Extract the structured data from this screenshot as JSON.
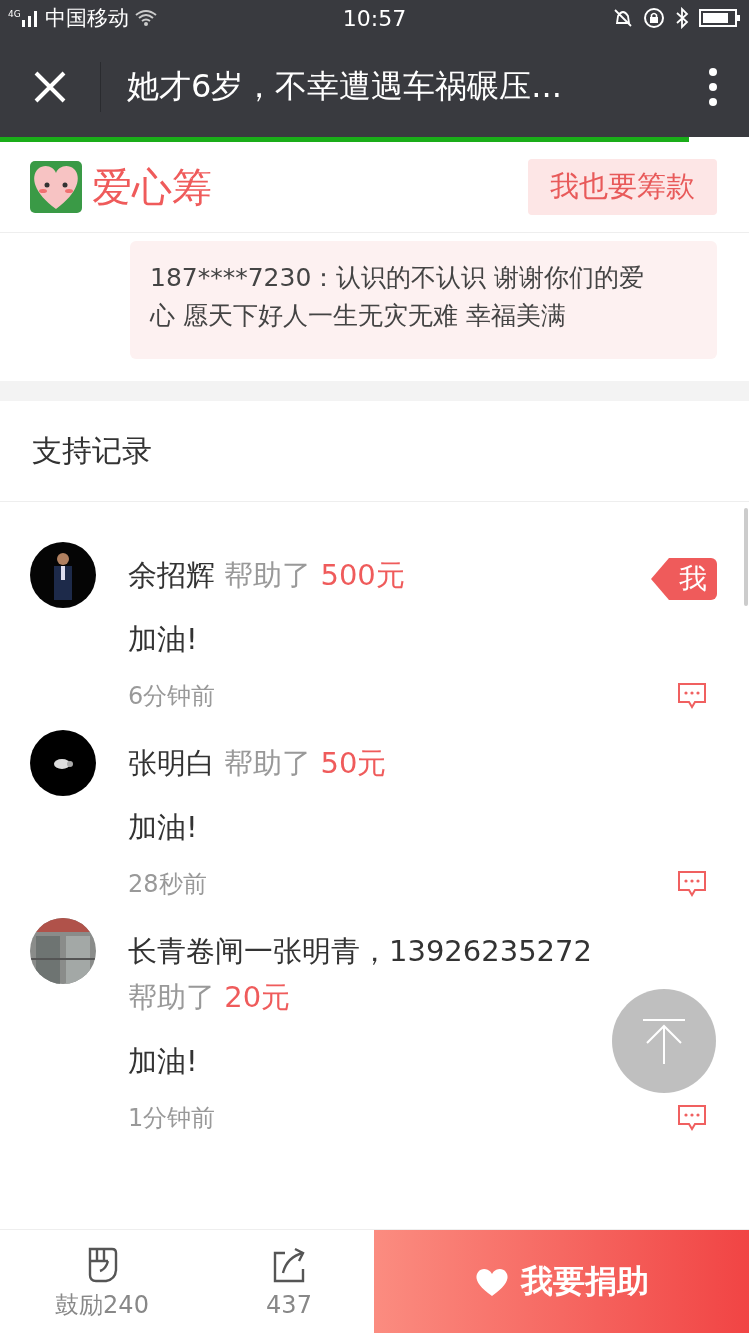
{
  "status_bar": {
    "network": "4G",
    "carrier": "中国移动",
    "time": "10:57"
  },
  "nav": {
    "title": "她才6岁，不幸遭遇车祸碾压...",
    "progress": {
      "level": 0.92
    }
  },
  "header": {
    "brand": "爱心筹",
    "action": "我也要筹款"
  },
  "comment": {
    "text": "187****7230：认识的不认识 谢谢你们的爱心 愿天下好人一生无灾无难 幸福美满"
  },
  "section_title": "支持记录",
  "records": [
    {
      "name": "余招辉",
      "action": "帮助了",
      "amount": "500元",
      "is_me": true,
      "me_label": "我",
      "message": "加油!",
      "time": "6分钟前"
    },
    {
      "name": "张明白",
      "action": "帮助了",
      "amount": "50元",
      "is_me": false,
      "message": "加油!",
      "time": "28秒前"
    },
    {
      "name": "长青卷闸一张明青，13926235272",
      "action": "帮助了",
      "amount": "20元",
      "is_me": false,
      "message": "加油!",
      "time": "1分钟前"
    }
  ],
  "bottom_bar": {
    "encourage": "鼓励240",
    "share": "437",
    "donate": "我要捐助"
  }
}
